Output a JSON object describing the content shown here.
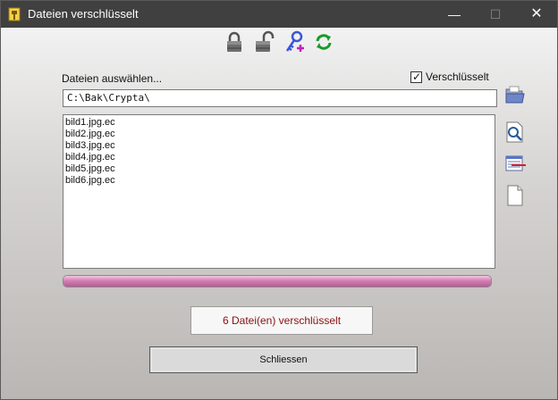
{
  "window": {
    "title": "Dateien verschlüsselt",
    "controls": {
      "minimize": "—",
      "maximize": "☐",
      "close": "✕"
    }
  },
  "toolbar": {
    "buttons": [
      {
        "icon": "lock-closed-icon"
      },
      {
        "icon": "lock-open-icon"
      },
      {
        "icon": "key-add-icon"
      },
      {
        "icon": "refresh-icon"
      }
    ]
  },
  "form": {
    "select_label": "Dateien auswählen...",
    "encrypted_checkbox": {
      "label": "Verschlüsselt",
      "checked": true
    },
    "path_value": "C:\\Bak\\Crypta\\"
  },
  "files": [
    "bild1.jpg.ec",
    "bild2.jpg.ec",
    "bild3.jpg.ec",
    "bild4.jpg.ec",
    "bild5.jpg.ec",
    "bild6.jpg.ec"
  ],
  "progress": {
    "value": 1.0
  },
  "side_buttons": [
    {
      "icon": "open-folder-icon"
    },
    {
      "icon": "search-icon"
    },
    {
      "icon": "list-delete-icon"
    },
    {
      "icon": "new-document-icon"
    }
  ],
  "status_text": "6 Datei(en) verschlüsselt",
  "close_button_label": "Schliessen",
  "colors": {
    "titlebar": "#404040",
    "status_text": "#8a1010",
    "progress": "#c66fa7"
  }
}
